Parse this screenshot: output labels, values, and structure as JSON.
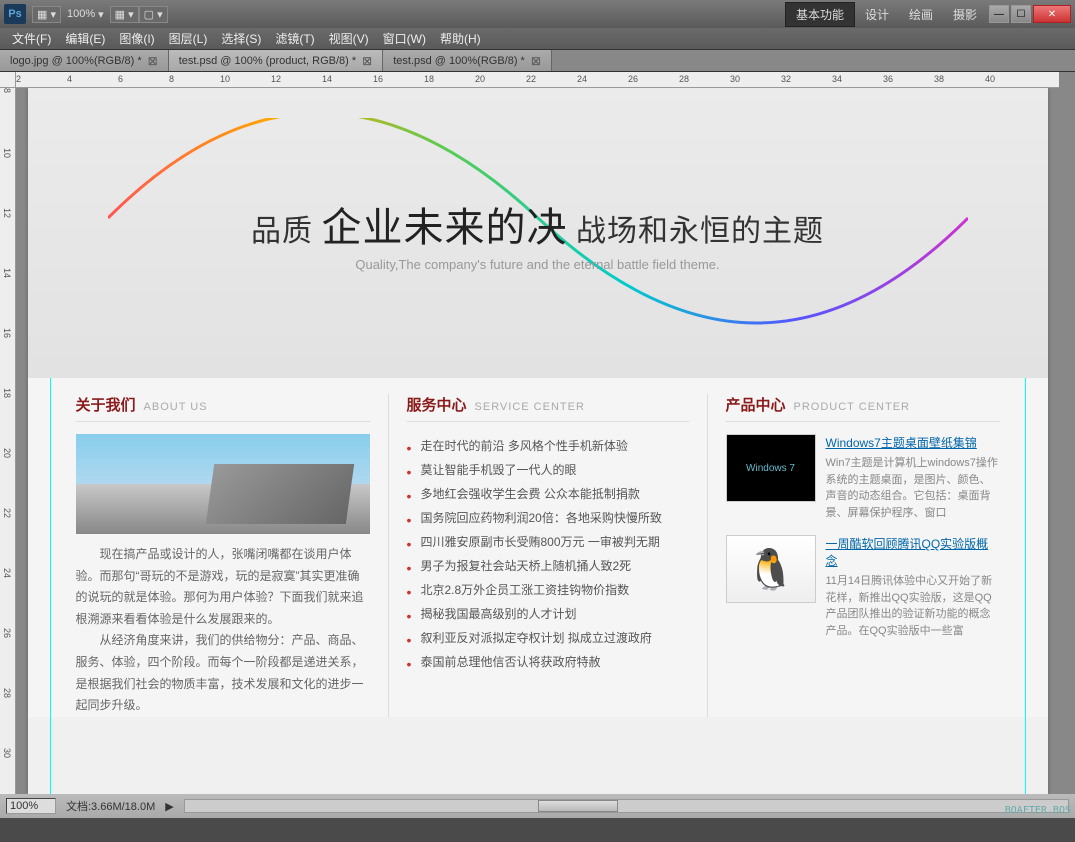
{
  "titlebar": {
    "logo": "Ps",
    "zoom": "100%"
  },
  "workspace": {
    "tabs": [
      "基本功能",
      "设计",
      "绘画",
      "摄影"
    ]
  },
  "menus": [
    "文件(F)",
    "编辑(E)",
    "图像(I)",
    "图层(L)",
    "选择(S)",
    "滤镜(T)",
    "视图(V)",
    "窗口(W)",
    "帮助(H)"
  ],
  "doctabs": [
    {
      "label": "logo.jpg @ 100%(RGB/8) *"
    },
    {
      "label": "test.psd @ 100% (product, RGB/8) *"
    },
    {
      "label": "test.psd @ 100%(RGB/8) *"
    }
  ],
  "ruler_h": [
    "2",
    "4",
    "6",
    "8",
    "10",
    "12",
    "14",
    "16",
    "18",
    "20",
    "22",
    "24",
    "26",
    "28",
    "30",
    "32",
    "34",
    "36",
    "38",
    "40"
  ],
  "ruler_v": [
    "8",
    "10",
    "12",
    "14",
    "16",
    "18",
    "20",
    "22",
    "24",
    "26",
    "28",
    "30"
  ],
  "hero": {
    "title_a": "品质",
    "title_b": "企业未来的",
    "title_c": "决",
    "title_d": "战场和永恒的主题",
    "sub": "Quality,The company's future and the eternal battle field theme."
  },
  "sections": {
    "about": {
      "cn": "关于我们",
      "en": "ABOUT US",
      "p1": "现在搞产品或设计的人，张嘴闭嘴都在谈用户体验。而那句“哥玩的不是游戏，玩的是寂寞”其实更准确的说玩的就是体验。那何为用户体验？下面我们就来追根溯源来看看体验是什么发展跟来的。",
      "p2": "从经济角度来讲，我们的供给物分：产品、商品、服务、体验，四个阶段。而每个一阶段都是递进关系，是根据我们社会的物质丰富，技术发展和文化的进步一起同步升级。"
    },
    "service": {
      "cn": "服务中心",
      "en": "SERVICE CENTER",
      "items": [
        "走在时代的前沿 多风格个性手机新体验",
        "莫让智能手机毁了一代人的眼",
        "多地红会强收学生会费 公众本能抵制捐款",
        "国务院回应药物利润20倍：各地采购快慢所致",
        "四川雅安原副市长受贿800万元 一审被判无期",
        "男子为报复社会站天桥上随机捅人致2死",
        "北京2.8万外企员工涨工资挂钩物价指数",
        "揭秘我国最高级别的人才计划",
        "叙利亚反对派拟定夺权计划 拟成立过渡政府",
        "泰国前总理他信否认将获政府特赦"
      ]
    },
    "product": {
      "cn": "产品中心",
      "en": "PRODUCT CENTER",
      "items": [
        {
          "title": "Windows7主题桌面壁纸集锦",
          "desc": "Win7主题是计算机上windows7操作系统的主题桌面，是图片、颜色、声音的动态组合。它包括：桌面背景、屏幕保护程序、窗口",
          "thumb": "Windows 7"
        },
        {
          "title": "一周酷软回顾腾讯QQ实验版概念",
          "desc": "11月14日腾讯体验中心又开始了新花样，新推出QQ实验版，这是QQ产品团队推出的验证新功能的概念产品。在QQ实验版中一些富",
          "thumb": "🐧"
        }
      ]
    }
  },
  "status": {
    "zoom": "100%",
    "doc": "文档:3.66M/18.0M",
    "watermark": "BOAFTER.BOS"
  }
}
